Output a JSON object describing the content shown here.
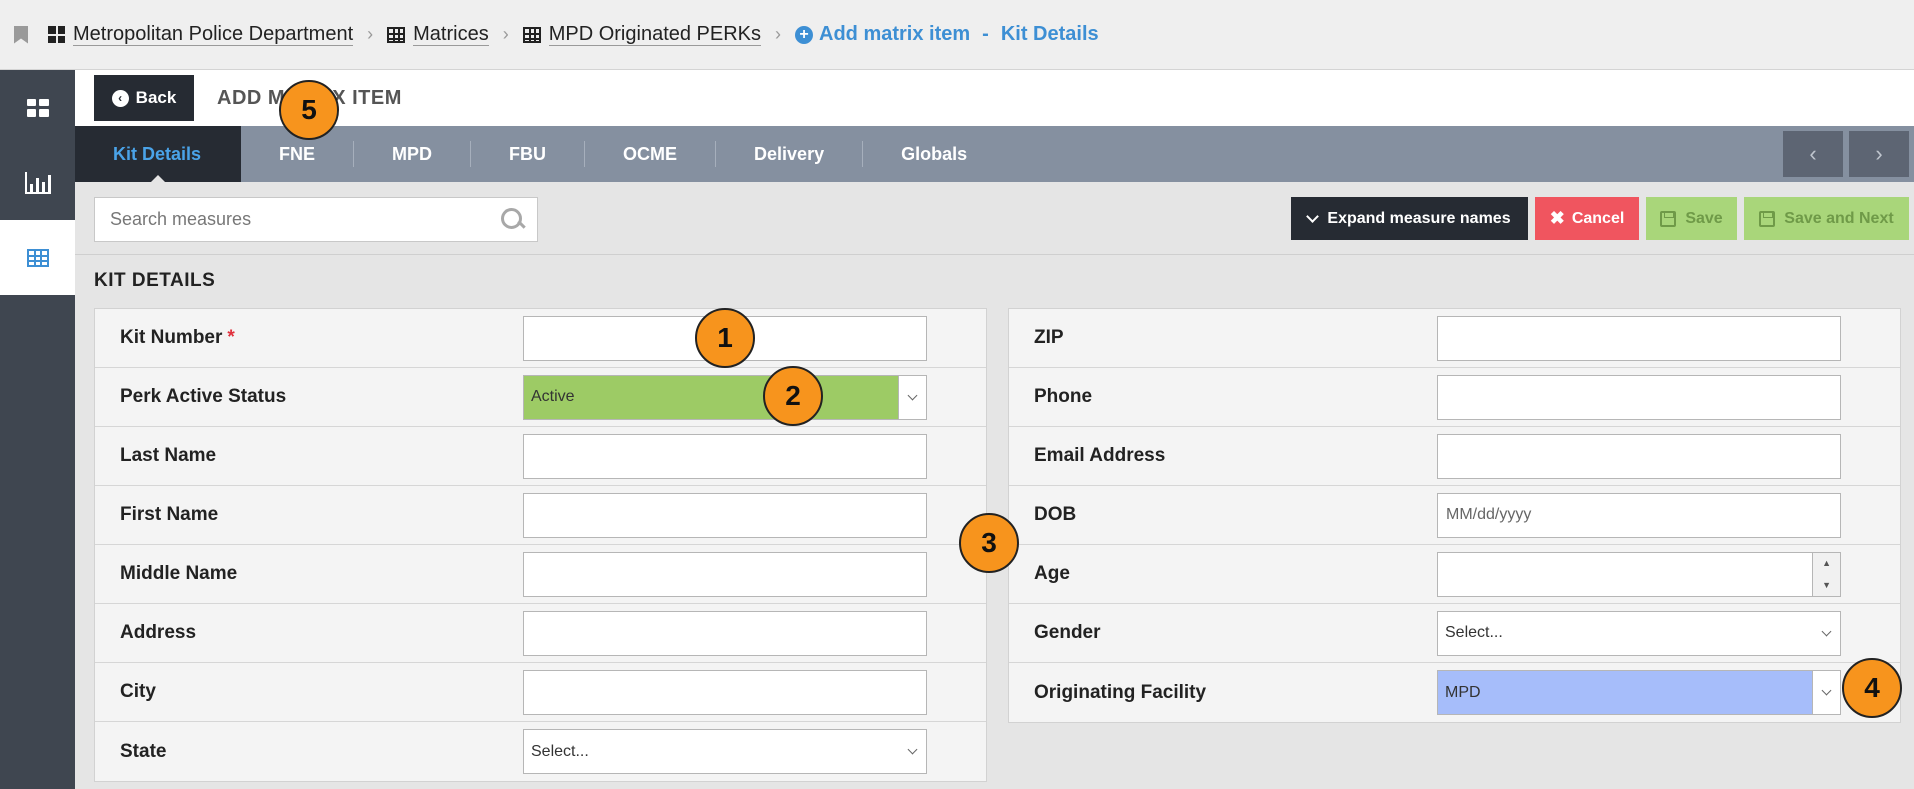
{
  "breadcrumb": {
    "items": [
      {
        "label": "Metropolitan Police Department",
        "icon": "dashboard-icon"
      },
      {
        "label": "Matrices",
        "icon": "table-icon"
      },
      {
        "label": "MPD Originated PERKs",
        "icon": "table-icon"
      }
    ],
    "current": {
      "label": "Add matrix item",
      "separator": "-",
      "section": "Kit Details"
    }
  },
  "sidebar": {
    "items": [
      {
        "icon": "dashboard-icon",
        "active": false
      },
      {
        "icon": "bar-chart-icon",
        "active": false
      },
      {
        "icon": "table-icon",
        "active": true
      }
    ]
  },
  "header": {
    "back_label": "Back",
    "title": "ADD MATRIX ITEM"
  },
  "tabs": [
    {
      "label": "Kit Details",
      "active": true
    },
    {
      "label": "FNE"
    },
    {
      "label": "MPD"
    },
    {
      "label": "FBU"
    },
    {
      "label": "OCME"
    },
    {
      "label": "Delivery"
    },
    {
      "label": "Globals"
    }
  ],
  "toolbar": {
    "search_placeholder": "Search measures",
    "expand_label": "Expand measure names",
    "cancel_label": "Cancel",
    "save_label": "Save",
    "save_next_label": "Save and Next"
  },
  "section": {
    "title": "KIT DETAILS"
  },
  "form_left": [
    {
      "label": "Kit Number",
      "required": true,
      "type": "text",
      "value": ""
    },
    {
      "label": "Perk Active Status",
      "type": "select",
      "value": "Active"
    },
    {
      "label": "Last Name",
      "type": "text",
      "value": ""
    },
    {
      "label": "First Name",
      "type": "text",
      "value": ""
    },
    {
      "label": "Middle Name",
      "type": "text",
      "value": ""
    },
    {
      "label": "Address",
      "type": "text",
      "value": ""
    },
    {
      "label": "City",
      "type": "text",
      "value": ""
    },
    {
      "label": "State",
      "type": "select",
      "value": "Select..."
    }
  ],
  "form_right": [
    {
      "label": "ZIP",
      "type": "text",
      "value": ""
    },
    {
      "label": "Phone",
      "type": "text",
      "value": ""
    },
    {
      "label": "Email Address",
      "type": "text",
      "value": ""
    },
    {
      "label": "DOB",
      "type": "date",
      "placeholder": "MM/dd/yyyy"
    },
    {
      "label": "Age",
      "type": "number",
      "value": ""
    },
    {
      "label": "Gender",
      "type": "select",
      "value": "Select..."
    },
    {
      "label": "Originating Facility",
      "type": "select",
      "value": "MPD"
    }
  ],
  "required_mark": "*",
  "spinner": {
    "up": "▲",
    "down": "▼"
  },
  "markers": [
    "1",
    "2",
    "3",
    "4",
    "5"
  ],
  "colors": {
    "accent": "#3d8fd4",
    "active_status": "#9dcb65",
    "facility": "#a6bdfa",
    "cancel": "#f0555f",
    "save": "#a9d67a",
    "marker": "#f7941d"
  }
}
